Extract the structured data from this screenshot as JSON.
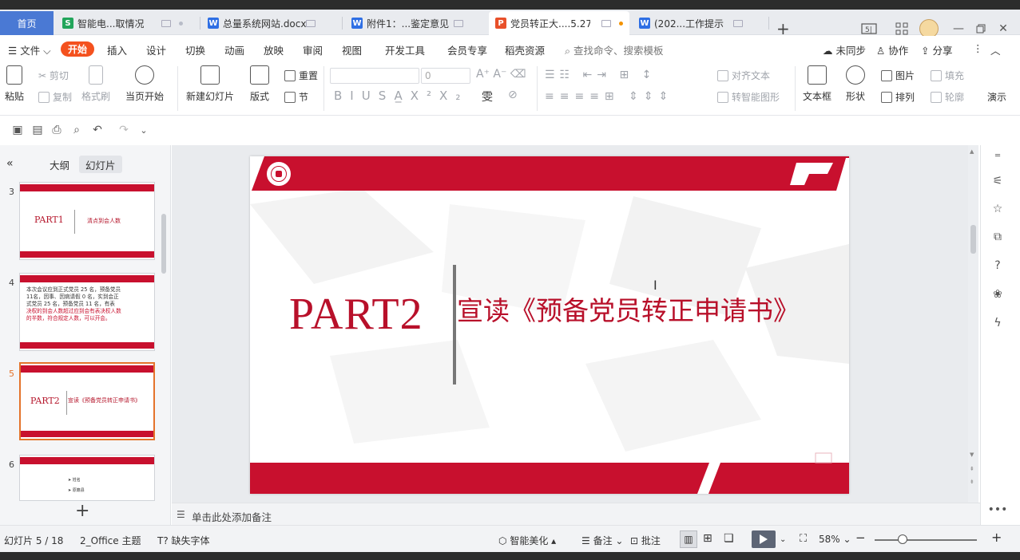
{
  "tabs": {
    "home": "首页",
    "items": [
      {
        "label": "智能电...取情况",
        "icon": "S",
        "color": "#22a55b",
        "state": "normal"
      },
      {
        "label": "总量系统网站.docx",
        "icon": "W",
        "color": "#2f6fe4",
        "state": "normal"
      },
      {
        "label": "附件1：...鉴定意见",
        "icon": "W",
        "color": "#2f6fe4",
        "state": "normal"
      },
      {
        "label": "党员转正大....5.27",
        "icon": "P",
        "color": "#e8502a",
        "state": "active"
      },
      {
        "label": "(202...工作提示",
        "icon": "W",
        "color": "#2f6fe4",
        "state": "normal"
      }
    ],
    "plus": "+"
  },
  "menu": {
    "file": "文件",
    "items": [
      "开始",
      "插入",
      "设计",
      "切换",
      "动画",
      "放映",
      "审阅",
      "视图",
      "开发工具",
      "会员专享",
      "稻壳资源"
    ],
    "search_placeholder": "查找命令、搜索模板",
    "unsynced": "未同步",
    "collaborate": "协作",
    "share": "分享"
  },
  "ribbon": {
    "paste": "粘贴",
    "cut": "剪切",
    "copy": "复制",
    "format_painter": "格式刷",
    "play_from_current": "当页开始",
    "new_slide": "新建幻灯片",
    "layout": "版式",
    "reset": "重置",
    "section": "节",
    "font_size": "0",
    "align_text": "对齐文本",
    "smart_shape": "转智能图形",
    "text_box": "文本框",
    "shape": "形状",
    "picture": "图片",
    "fill": "填充",
    "arrange": "排列",
    "outline": "轮廓",
    "presenter": "演示"
  },
  "panel": {
    "tab_outline": "大纲",
    "tab_slides": "幻灯片",
    "thumbs": [
      {
        "num": "3",
        "part": "PART1",
        "title": "清点到会人数"
      },
      {
        "num": "4",
        "line1": "本次会议应到正式党员 25 名，预备党员",
        "line2": "11名，因事、因病请假 0 名，实到会正",
        "line3": "式党员  25 名，预备党员  11 名，有表",
        "line4": "决权的到会人数超过应到会有表决权人数",
        "line5": "的半数，符合规定人数，可以开会。"
      },
      {
        "num": "5",
        "part": "PART2",
        "title": "宣读《预备党员转正申请书》"
      },
      {
        "num": "6",
        "item1": "➤ 姓名",
        "item2": "➤ 原籍县"
      }
    ]
  },
  "slide": {
    "part": "PART2",
    "title": "宣读《预备党员转正申请书》"
  },
  "notes_placeholder": "单击此处添加备注",
  "status": {
    "slide_counter": "幻灯片 5 / 18",
    "theme": "2_Office 主题",
    "missing_font": "缺失字体",
    "beautify": "智能美化",
    "notes": "备注",
    "comments": "批注",
    "zoom": "58%"
  },
  "colors": {
    "brand_red": "#c8102e",
    "accent_orange": "#f4511e",
    "home_blue": "#4a79d4"
  }
}
